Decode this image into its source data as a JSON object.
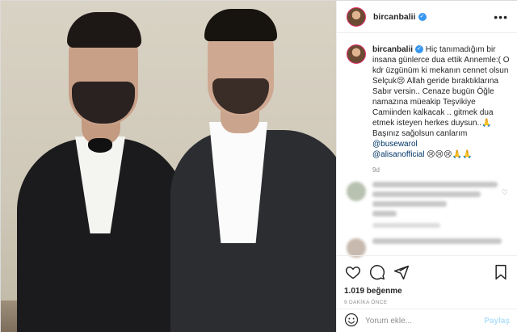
{
  "post": {
    "username": "bircanbalii",
    "verified": true,
    "caption_parts": [
      "Hiç tanımadığım bir insana günlerce dua ettik Annemle:( O kdr üzgünüm ki mekanın cennet olsun Selçuk😢 Allah geride bıraktıklarına Sabır versin.. Cenaze bugün Öğle namazına müeakip Teşvikiye Camiinden kalkacak .. gitmek dua etmek isteyen herkes duysun..🙏 Başınız sağolsun canlarım ",
      "@busewarol",
      "@alisanofficial",
      " 😢😢😢🙏🙏"
    ],
    "caption_age": "9d",
    "likes": "1.019 beğenme",
    "posted_time": "9 DAKİKA ÖNCE"
  },
  "comment_box": {
    "placeholder": "Yorum ekle...",
    "post_label": "Paylaş"
  },
  "icons": {
    "more": "more-options-icon",
    "like": "heart-icon",
    "comment": "comment-icon",
    "share": "share-icon",
    "save": "bookmark-icon",
    "emoji": "emoji-icon"
  },
  "colors": {
    "link": "#003569",
    "verified": "#3897f0",
    "muted": "#8e8e8e",
    "post_button_disabled": "#b2dffc"
  }
}
